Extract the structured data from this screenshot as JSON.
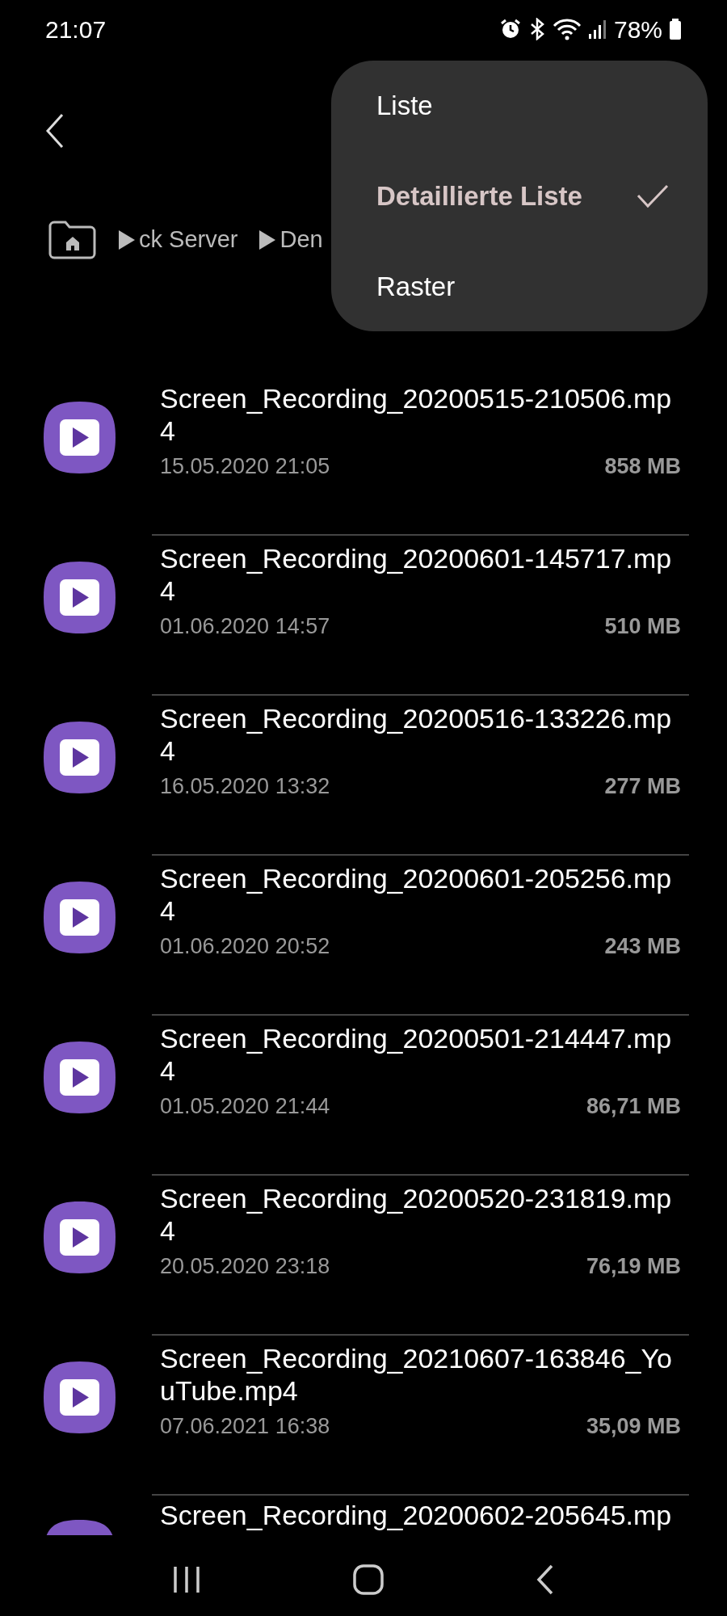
{
  "status_bar": {
    "time": "21:07",
    "battery": "78%"
  },
  "breadcrumb": [
    "ck Server",
    "Den"
  ],
  "menu": [
    {
      "label": "Liste",
      "selected": false
    },
    {
      "label": "Detaillierte Liste",
      "selected": true
    },
    {
      "label": "Raster",
      "selected": false
    }
  ],
  "files": [
    {
      "name": "Screen_Recording_20200515-210506.mp4",
      "date": "15.05.2020 21:05",
      "size": "858 MB"
    },
    {
      "name": "Screen_Recording_20200601-145717.mp4",
      "date": "01.06.2020 14:57",
      "size": "510 MB"
    },
    {
      "name": "Screen_Recording_20200516-133226.mp4",
      "date": "16.05.2020 13:32",
      "size": "277 MB"
    },
    {
      "name": "Screen_Recording_20200601-205256.mp4",
      "date": "01.06.2020 20:52",
      "size": "243 MB"
    },
    {
      "name": "Screen_Recording_20200501-214447.mp4",
      "date": "01.05.2020 21:44",
      "size": "86,71 MB"
    },
    {
      "name": "Screen_Recording_20200520-231819.mp4",
      "date": "20.05.2020 23:18",
      "size": "76,19 MB"
    },
    {
      "name": "Screen_Recording_20210607-163846_YouTube.mp4",
      "date": "07.06.2021 16:38",
      "size": "35,09 MB"
    }
  ],
  "partial_file": {
    "name": "Screen_Recording_20200602-205645.mp"
  }
}
